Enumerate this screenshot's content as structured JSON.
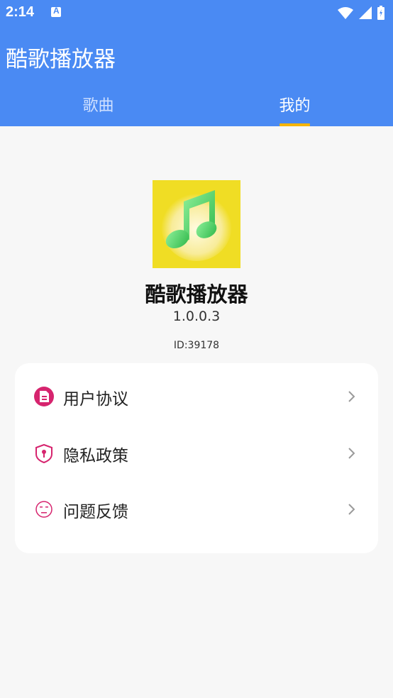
{
  "status_bar": {
    "time": "2:14"
  },
  "app_bar": {
    "title": "酷歌播放器"
  },
  "tabs": [
    {
      "label": "歌曲",
      "active": false
    },
    {
      "label": "我的",
      "active": true
    }
  ],
  "profile": {
    "app_name": "酷歌播放器",
    "version": "1.0.0.3",
    "id": "ID:39178"
  },
  "menu": [
    {
      "label": "用户协议",
      "icon": "document-icon"
    },
    {
      "label": "隐私政策",
      "icon": "shield-lock-icon"
    },
    {
      "label": "问题反馈",
      "icon": "feedback-face-icon"
    }
  ],
  "colors": {
    "primary": "#4a8af3",
    "indicator": "#f5b400",
    "icon_accent": "#d6246e",
    "logo_bg": "#f0dd24"
  }
}
